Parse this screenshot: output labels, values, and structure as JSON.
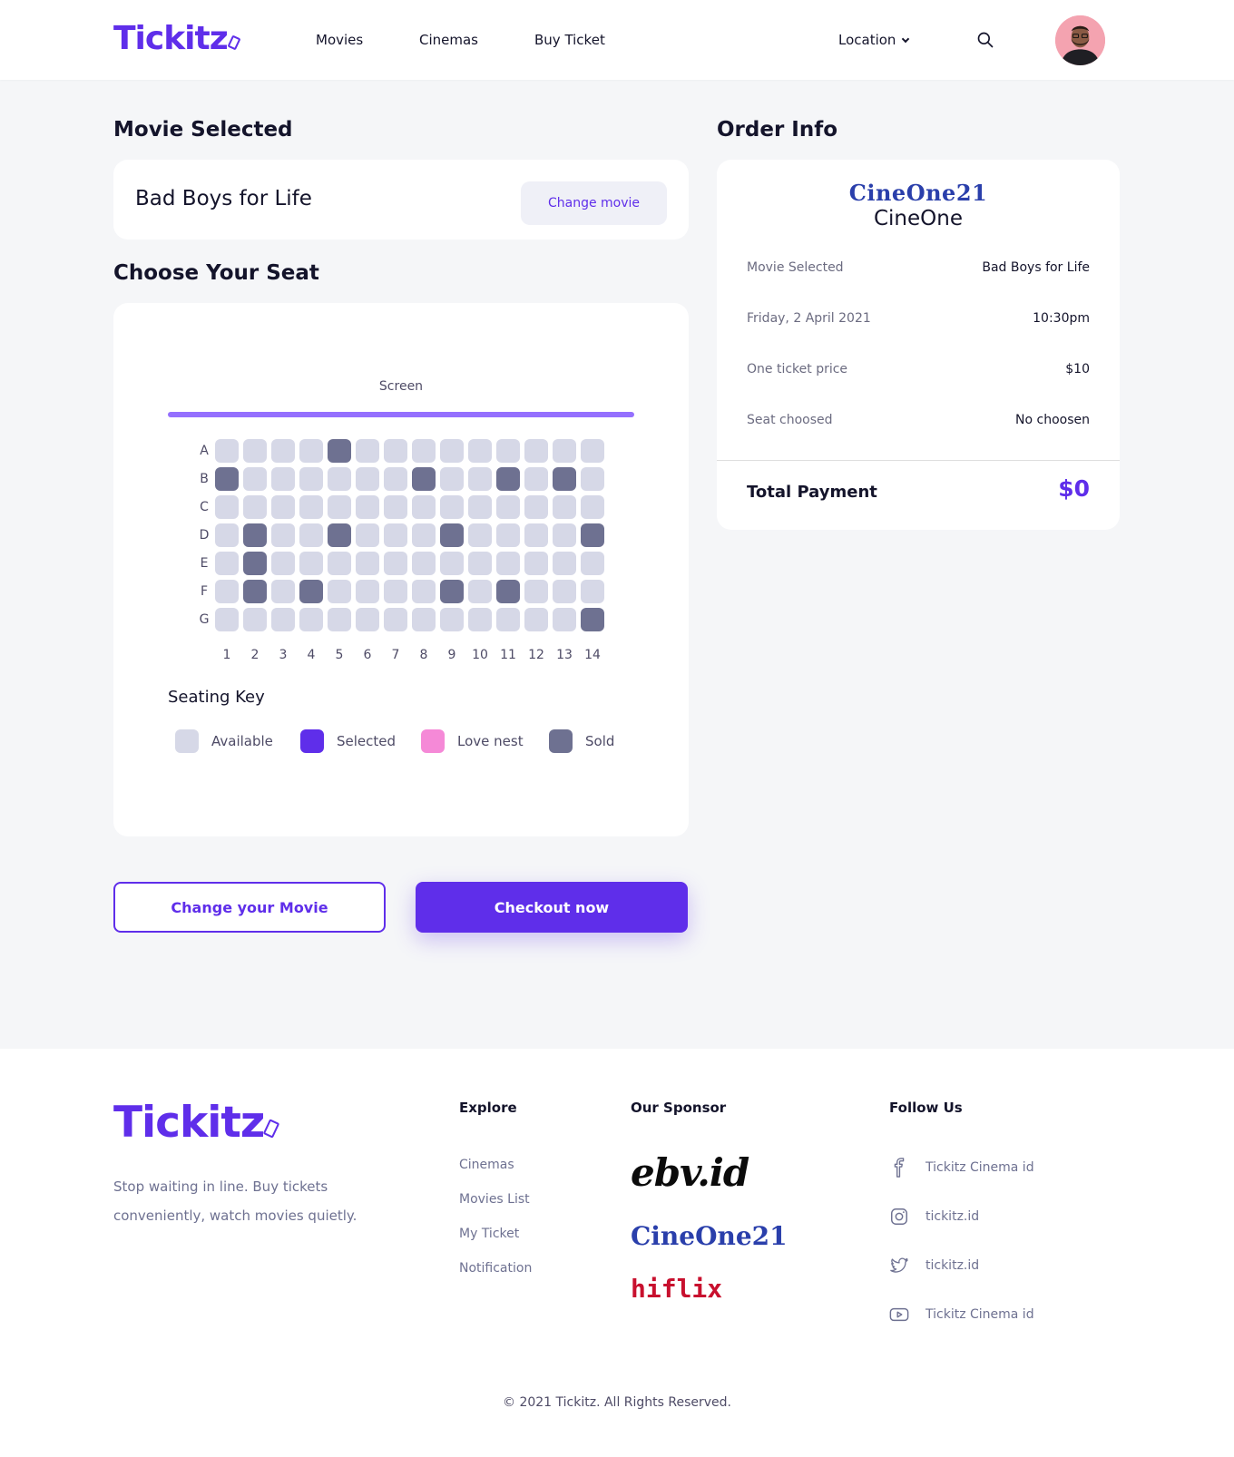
{
  "header": {
    "logo": "Tickitz",
    "nav": [
      "Movies",
      "Cinemas",
      "Buy Ticket"
    ],
    "location": "Location"
  },
  "movie_selected": {
    "title": "Movie Selected",
    "movie_name": "Bad Boys for Life",
    "change_label": "Change movie"
  },
  "seats": {
    "title": "Choose Your Seat",
    "screen_label": "Screen",
    "rows": [
      "A",
      "B",
      "C",
      "D",
      "E",
      "F",
      "G"
    ],
    "columns": [
      "1",
      "2",
      "3",
      "4",
      "5",
      "6",
      "7",
      "8",
      "9",
      "10",
      "11",
      "12",
      "13",
      "14"
    ],
    "sold": {
      "A": [
        5
      ],
      "B": [
        1,
        8,
        11,
        13
      ],
      "C": [],
      "D": [
        2,
        5,
        9,
        14
      ],
      "E": [
        2
      ],
      "F": [
        2,
        4,
        9,
        11
      ],
      "G": [
        14
      ]
    },
    "key_title": "Seating Key",
    "key": [
      {
        "label": "Available",
        "color": "#d6d8e7"
      },
      {
        "label": "Selected",
        "color": "#5f2eea"
      },
      {
        "label": "Love nest",
        "color": "#f589d7"
      },
      {
        "label": "Sold",
        "color": "#6e7191"
      }
    ]
  },
  "actions": {
    "change_movie": "Change your Movie",
    "checkout": "Checkout now"
  },
  "order_info": {
    "title": "Order Info",
    "cinema_logo": "CineOne21",
    "cinema_name": "CineOne",
    "rows": [
      {
        "label": "Movie Selected",
        "value": "Bad Boys for Life"
      },
      {
        "label": "Friday, 2 April 2021",
        "value": "10:30pm"
      },
      {
        "label": "One ticket price",
        "value": "$10"
      },
      {
        "label": "Seat choosed",
        "value": "No choosen"
      }
    ],
    "total_label": "Total Payment",
    "total_value": "$0"
  },
  "footer": {
    "logo": "Tickitz",
    "tagline": "Stop waiting in line. Buy tickets conveniently, watch movies quietly.",
    "explore_title": "Explore",
    "explore_links": [
      "Cinemas",
      "Movies List",
      "My Ticket",
      "Notification"
    ],
    "sponsor_title": "Our Sponsor",
    "sponsors": [
      "ebv.id",
      "CineOne21",
      "hiflix"
    ],
    "follow_title": "Follow Us",
    "socials": [
      {
        "icon": "facebook-icon",
        "label": "Tickitz Cinema id"
      },
      {
        "icon": "instagram-icon",
        "label": "tickitz.id"
      },
      {
        "icon": "twitter-icon",
        "label": "tickitz.id"
      },
      {
        "icon": "youtube-icon",
        "label": "Tickitz Cinema id"
      }
    ],
    "copyright": "© 2021 Tickitz. All Rights Reserved."
  },
  "colors": {
    "brand": "#5f2eea",
    "seat_available": "#d6d8e7",
    "seat_sold": "#6e7191",
    "screen": "#9570fe"
  }
}
